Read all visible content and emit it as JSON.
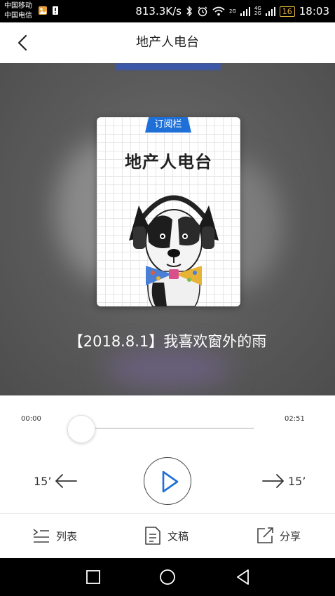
{
  "status_bar": {
    "carrier_1": "中国移动",
    "carrier_2": "中国电信",
    "net_speed": "813.3K/s",
    "net_2g": "2G",
    "net_4g": "4G",
    "net_2g_b": "2G",
    "battery": "16",
    "time": "18:03",
    "icons": [
      "photo-notification-icon",
      "alert-notification-icon",
      "bluetooth-icon",
      "alarm-icon",
      "wifi-icon",
      "signal-icon"
    ]
  },
  "header": {
    "title": "地产人电台",
    "back_icon": "chevron-left-icon"
  },
  "cover": {
    "badge": "订阅栏",
    "title": "地产人电台",
    "illustration": "dog-with-headphones-and-bowtie"
  },
  "episode": {
    "title": "【2018.8.1】我喜欢窗外的雨"
  },
  "player": {
    "current_time": "00:00",
    "total_time": "02:51",
    "progress": 0,
    "rewind_label": "15’",
    "forward_label": "15’",
    "play_icon": "play-icon"
  },
  "actions": [
    {
      "label": "列表",
      "icon": "list-icon"
    },
    {
      "label": "文稿",
      "icon": "document-icon"
    },
    {
      "label": "分享",
      "icon": "share-icon"
    }
  ],
  "colors": {
    "accent": "#1f6fd8",
    "hero_bg": "#5a5a5a",
    "status_bar": "#000000",
    "battery": "#e3b23c"
  }
}
